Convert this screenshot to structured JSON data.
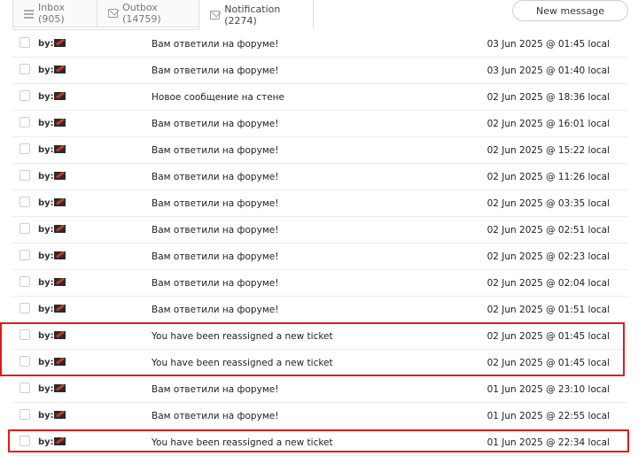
{
  "tabs": [
    {
      "label": "Inbox (905)",
      "icon": "list-icon"
    },
    {
      "label": "Outbox (14759)",
      "icon": "envelope-icon"
    },
    {
      "label": "Notification (2274)",
      "icon": "envelope-icon"
    }
  ],
  "new_message_label": "New message",
  "by_label": "by:",
  "messages": [
    {
      "subject": "Вам ответили на форуме!",
      "date": "03 Jun 2025 @ 01:45 local"
    },
    {
      "subject": "Вам ответили на форуме!",
      "date": "03 Jun 2025 @ 01:40 local"
    },
    {
      "subject": "Новое сообщение на стене",
      "date": "02 Jun 2025 @ 18:36 local"
    },
    {
      "subject": "Вам ответили на форуме!",
      "date": "02 Jun 2025 @ 16:01 local"
    },
    {
      "subject": "Вам ответили на форуме!",
      "date": "02 Jun 2025 @ 15:22 local"
    },
    {
      "subject": "Вам ответили на форуме!",
      "date": "02 Jun 2025 @ 11:26 local"
    },
    {
      "subject": "Вам ответили на форуме!",
      "date": "02 Jun 2025 @ 03:35 local"
    },
    {
      "subject": "Вам ответили на форуме!",
      "date": "02 Jun 2025 @ 02:51 local"
    },
    {
      "subject": "Вам ответили на форуме!",
      "date": "02 Jun 2025 @ 02:23 local"
    },
    {
      "subject": "Вам ответили на форуме!",
      "date": "02 Jun 2025 @ 02:04 local"
    },
    {
      "subject": "Вам ответили на форуме!",
      "date": "02 Jun 2025 @ 01:51 local"
    },
    {
      "subject": "You have been reassigned a new ticket",
      "date": "02 Jun 2025 @ 01:45 local"
    },
    {
      "subject": "You have been reassigned a new ticket",
      "date": "02 Jun 2025 @ 01:45 local"
    },
    {
      "subject": "Вам ответили на форуме!",
      "date": "01 Jun 2025 @ 23:10 local"
    },
    {
      "subject": "Вам ответили на форуме!",
      "date": "01 Jun 2025 @ 22:55 local"
    },
    {
      "subject": "You have been reassigned a new ticket",
      "date": "01 Jun 2025 @ 22:34 local"
    }
  ],
  "highlight_color": "#e01b1b"
}
